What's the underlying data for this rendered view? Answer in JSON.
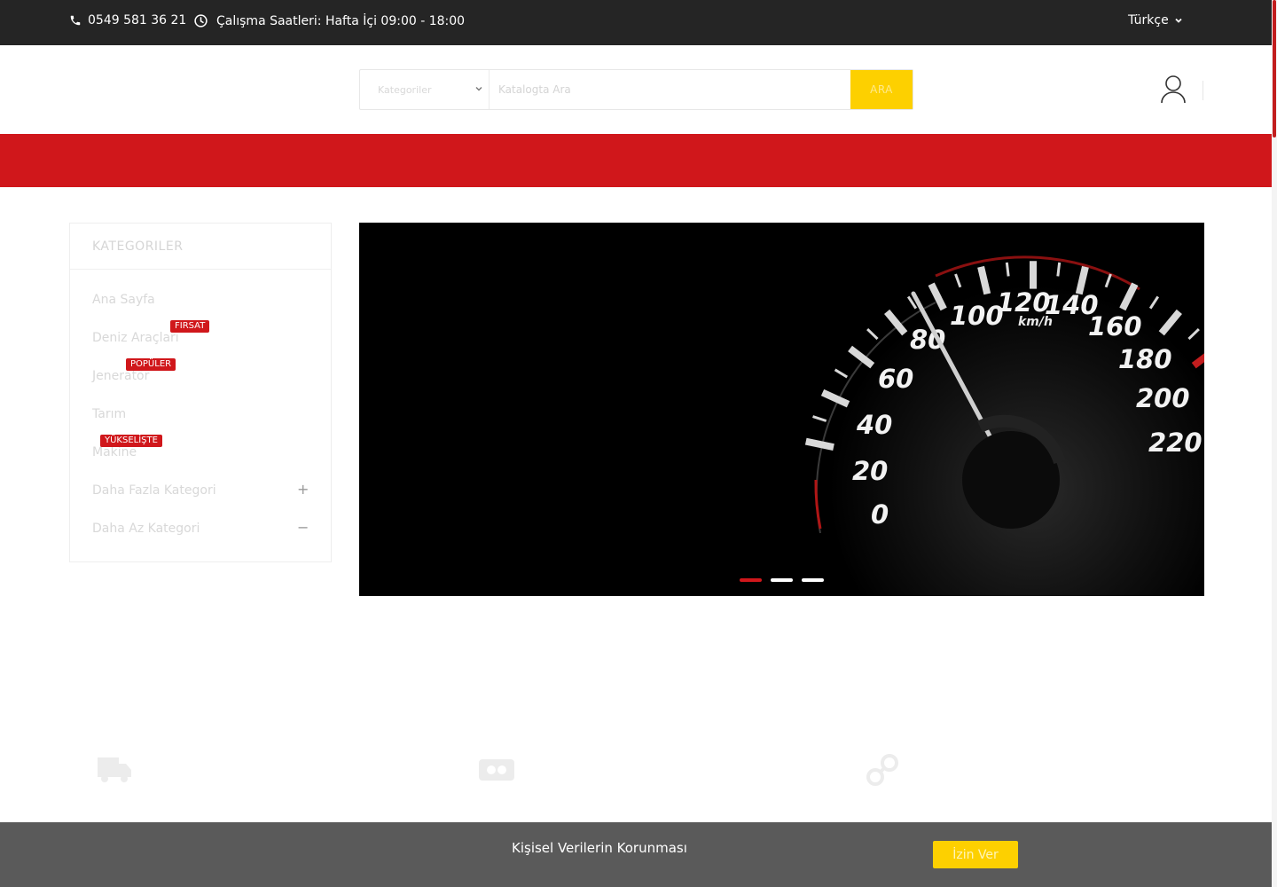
{
  "topbar": {
    "phone": "0549 581 36 21",
    "hours": "Çalışma Saatleri: Hafta İçi 09:00 - 18:00",
    "language": "Türkçe"
  },
  "search": {
    "category_label": "Kategoriler",
    "placeholder": "Katalogta Ara",
    "button_label": "ARA"
  },
  "sidebar": {
    "title": "KATEGORILER",
    "items": [
      {
        "label": "Ana Sayfa",
        "badge": ""
      },
      {
        "label": "Deniz Araçları",
        "badge": "FIRSAT"
      },
      {
        "label": "Jeneratör",
        "badge": "POPÜLER"
      },
      {
        "label": "Tarım",
        "badge": ""
      },
      {
        "label": "Makine",
        "badge": "YÜKSELİŞTE"
      },
      {
        "label": "Daha Fazla Kategori",
        "badge": "",
        "toggle": "+"
      },
      {
        "label": "Daha Az Kategori",
        "badge": "",
        "toggle": "−"
      }
    ]
  },
  "hero": {
    "speedometer_labels": [
      "0",
      "20",
      "40",
      "60",
      "80",
      "100",
      "120",
      "140",
      "160",
      "180",
      "200",
      "220"
    ],
    "speed_unit": "km/h",
    "slide_count": 3,
    "active_slide": 1
  },
  "cookie": {
    "title": "Kişisel Verilerin Korunması",
    "accept_label": "İzin Ver"
  },
  "colors": {
    "topbar_bg": "#252525",
    "accent_red": "#d0171b",
    "accent_yellow": "#fdd000",
    "cookie_bg": "#5a5a5a"
  }
}
